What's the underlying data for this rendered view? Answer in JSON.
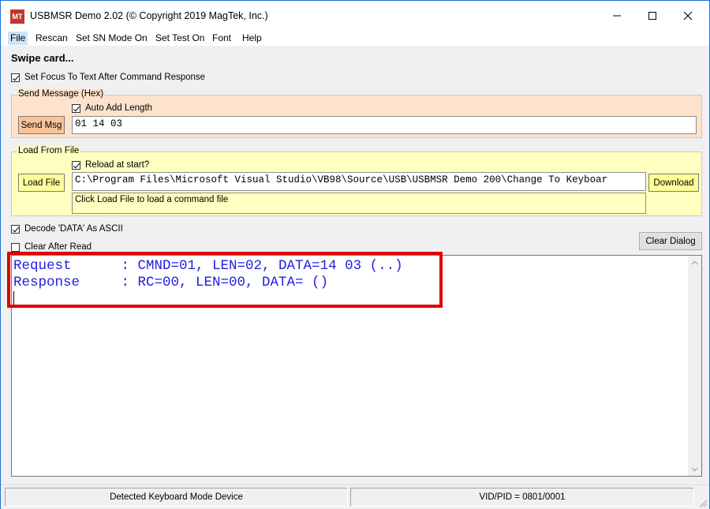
{
  "window": {
    "icon_text": "MT",
    "title": "USBMSR Demo 2.02 (© Copyright 2019 MagTek, Inc.)"
  },
  "menu": [
    {
      "label": "File"
    },
    {
      "label": "Rescan"
    },
    {
      "label": "Set SN Mode On"
    },
    {
      "label": "Set Test On"
    },
    {
      "label": "Font"
    },
    {
      "label": "Help"
    }
  ],
  "status_message": "Swipe card...",
  "set_focus_checkbox": {
    "label": "Set Focus To Text After Command Response",
    "checked": true
  },
  "send_message": {
    "legend": "Send Message (Hex)",
    "auto_add_length": {
      "label": "Auto Add Length",
      "checked": true
    },
    "button_label": "Send Msg",
    "value": "01 14 03"
  },
  "load_from_file": {
    "legend": "Load From File",
    "reload_at_start": {
      "label": "Reload at start?",
      "checked": true
    },
    "load_button_label": "Load File",
    "path": "C:\\Program Files\\Microsoft Visual Studio\\VB98\\Source\\USB\\USBMSR Demo 200\\Change To Keyboar",
    "hint": "Click Load File to load a command file",
    "download_button_label": "Download"
  },
  "decode_ascii_checkbox": {
    "label": "Decode 'DATA' As ASCII",
    "checked": true
  },
  "clear_after_read_checkbox": {
    "label": "Clear After Read",
    "checked": false
  },
  "clear_dialog_label": "Clear Dialog",
  "output": {
    "lines": [
      "Request      : CMND=01, LEN=02, DATA=14 03 (..)",
      "Response     : RC=00, LEN=00, DATA= ()"
    ],
    "text_color": "#2020e0"
  },
  "statusbar": {
    "left": "Detected Keyboard Mode Device",
    "right": "VID/PID = 0801/0001"
  },
  "colors": {
    "send_group_bg": "#fde3cc",
    "send_button_bg": "#f9c49a",
    "load_group_bg": "#ffffc0",
    "load_button_bg": "#ffff99",
    "highlight": "#e00000"
  }
}
